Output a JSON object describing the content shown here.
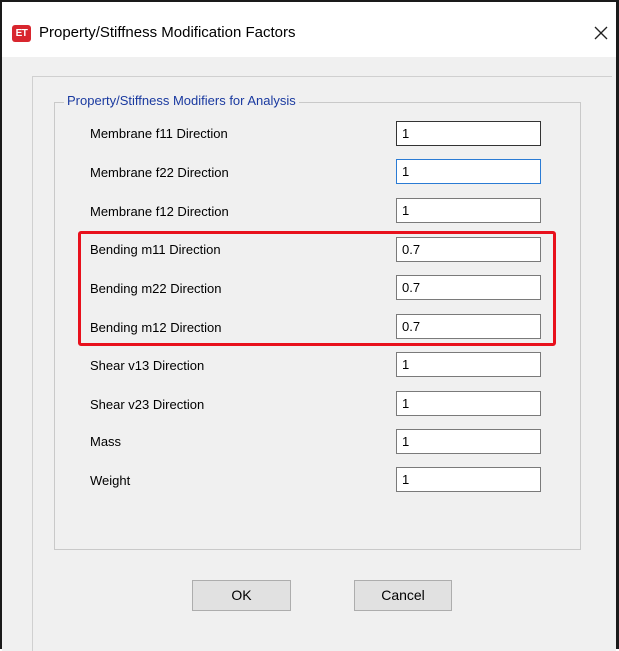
{
  "window": {
    "title": "Property/Stiffness Modification Factors",
    "app_icon_text": "ET",
    "icon": "etabs-app-icon",
    "close_icon": "close-icon"
  },
  "group": {
    "label": "Property/Stiffness Modifiers for Analysis"
  },
  "rows": [
    {
      "label": "Membrane f11 Direction",
      "value": "1"
    },
    {
      "label": "Membrane f22 Direction",
      "value": "1"
    },
    {
      "label": "Membrane f12 Direction",
      "value": "1"
    },
    {
      "label": "Bending m11 Direction",
      "value": "0.7"
    },
    {
      "label": "Bending m22 Direction",
      "value": "0.7"
    },
    {
      "label": "Bending m12 Direction",
      "value": "0.7"
    },
    {
      "label": "Shear v13 Direction",
      "value": "1"
    },
    {
      "label": "Shear v23 Direction",
      "value": "1"
    },
    {
      "label": "Mass",
      "value": "1"
    },
    {
      "label": "Weight",
      "value": "1"
    }
  ],
  "buttons": {
    "ok": "OK",
    "cancel": "Cancel"
  },
  "colors": {
    "highlight": "#e8101c",
    "group_label": "#1a3aa0",
    "dialog_bg": "#f0f0f0",
    "app_icon": "#d8262e"
  }
}
